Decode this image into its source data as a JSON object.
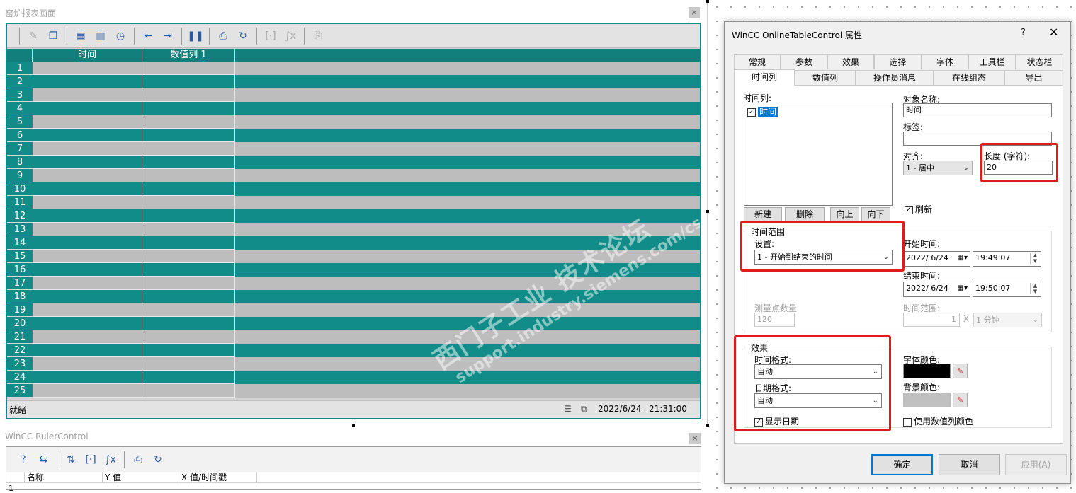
{
  "report_window": {
    "title": "窑炉报表画面",
    "close_label": "×",
    "columns": [
      "时间",
      "数值列 1"
    ],
    "row_numbers": [
      "1",
      "2",
      "3",
      "4",
      "5",
      "6",
      "7",
      "8",
      "9",
      "10",
      "11",
      "12",
      "13",
      "14",
      "15",
      "16",
      "17",
      "18",
      "19",
      "20",
      "21",
      "22",
      "23",
      "24",
      "25"
    ],
    "status_text": "就绪",
    "status_date": "2022/6/24",
    "status_time": "21:31:00",
    "watermark_line1": "西门子工业 技术论坛",
    "watermark_line2": "support.industry.siemens.com/cs",
    "colors": {
      "teal": "#118c88",
      "grey_row": "#bdbdbd"
    }
  },
  "ruler_window": {
    "title": "WinCC RulerControl",
    "close_label": "×",
    "columns": [
      "名称",
      "Y 值",
      "X 值/时间戳"
    ],
    "first_row_number": "1"
  },
  "dialog": {
    "title": "WinCC OnlineTableControl 属性",
    "help": "?",
    "close": "✕",
    "tabs_row1": [
      "常规",
      "参数",
      "效果",
      "选择",
      "字体",
      "工具栏",
      "状态栏"
    ],
    "tabs_row2": [
      "时间列",
      "数值列",
      "操作员消息",
      "在线组态",
      "导出"
    ],
    "time_columns_label": "时间列:",
    "time_column_item": "时间",
    "object_name_label": "对象名称:",
    "object_name_value": "时间",
    "tag_label": "标签:",
    "tag_value": "",
    "align_label": "对齐:",
    "align_value": "1 - 居中",
    "length_label": "长度 (字符):",
    "length_value": "20",
    "refresh_label": "刷新",
    "new_button": "新建",
    "delete_button": "删除",
    "up_button": "向上",
    "down_button": "向下",
    "time_range_group": "时间范围",
    "setting_label": "设置:",
    "setting_value": "1 - 开始到结束的时间",
    "start_time_label": "开始时间:",
    "start_date": "2022/ 6/24",
    "start_time": "19:49:07",
    "end_time_label": "结束时间:",
    "end_date": "2022/ 6/24",
    "end_time": "19:50:07",
    "measure_points_label": "测量点数量",
    "measure_points_value": "120",
    "time_range_label": "时间范围:",
    "time_range_value": "1",
    "time_range_x": "X",
    "time_range_unit": "1 分钟",
    "effect_group": "效果",
    "time_format_label": "时间格式:",
    "time_format_value": "自动",
    "date_format_label": "日期格式:",
    "date_format_value": "自动",
    "show_date_label": "显示日期",
    "font_color_label": "字体颜色:",
    "bg_color_label": "背景颜色:",
    "use_value_col_color_label": "使用数值列颜色",
    "ok_button": "确定",
    "cancel_button": "取消",
    "apply_button": "应用(A)",
    "colors": {
      "font_color": "#000000",
      "bg_color": "#c0c0c0",
      "highlight": "#e01b1b"
    }
  }
}
